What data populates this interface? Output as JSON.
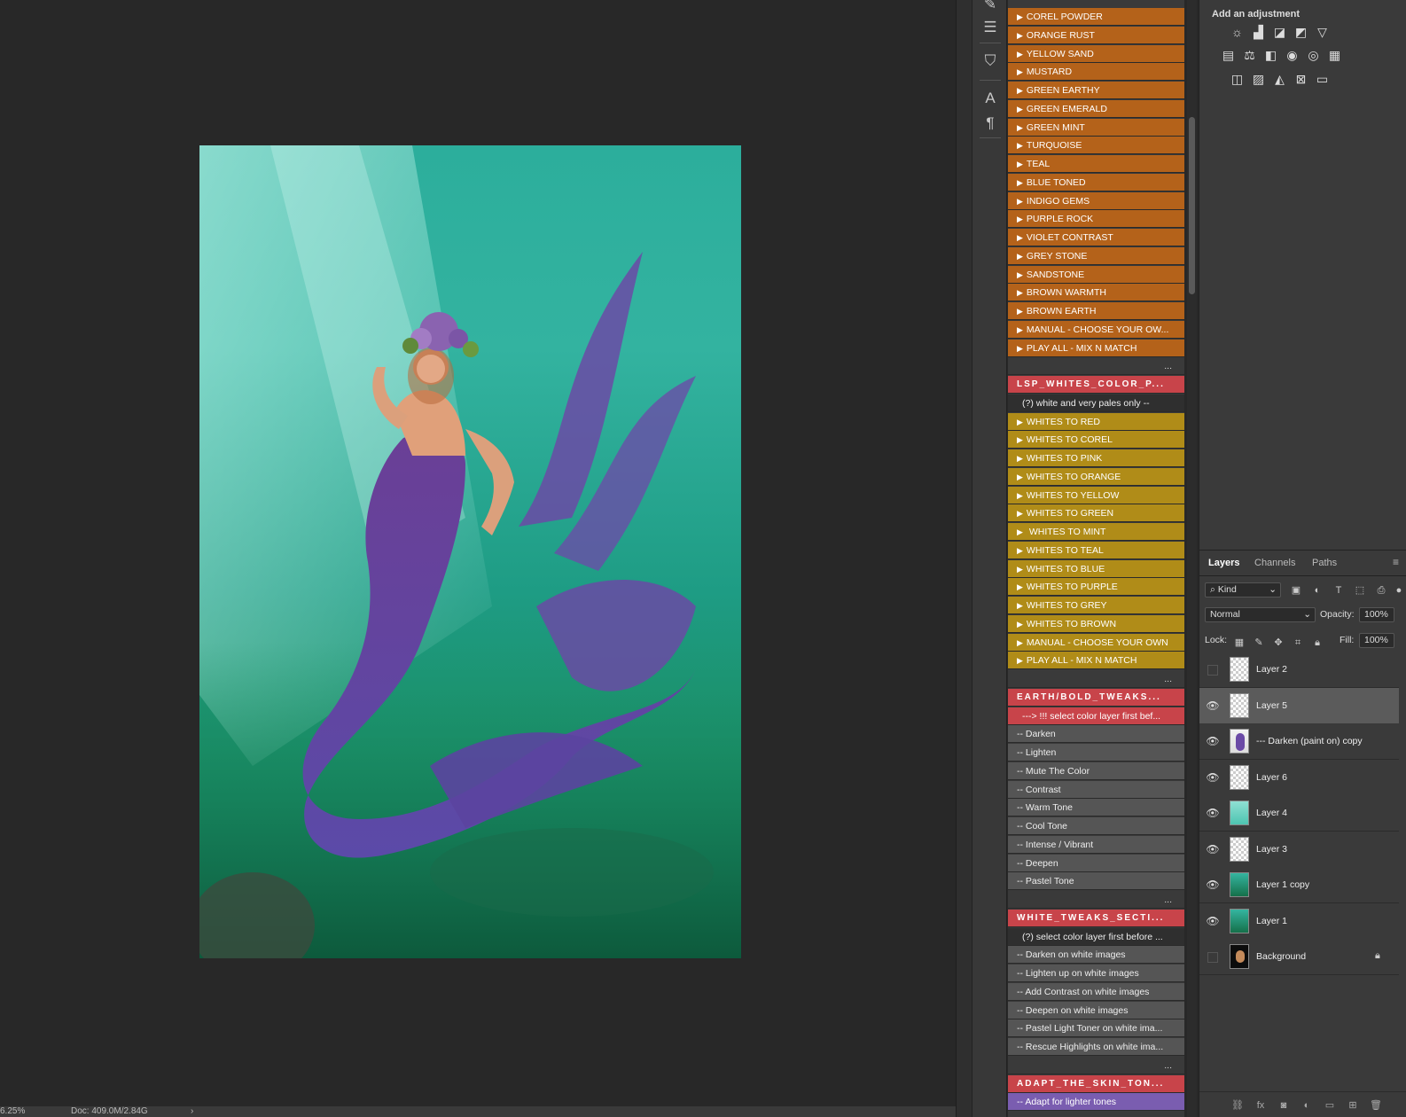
{
  "status": {
    "zoom": "6.25%",
    "doc": "Doc: 409.0M/2.84G",
    "arrow": "›"
  },
  "actions": {
    "group1": [
      "COREL POWDER",
      "ORANGE RUST",
      "YELLOW SAND",
      "MUSTARD",
      "GREEN EARTHY",
      "GREEN EMERALD",
      "GREEN MINT",
      "TURQUOISE",
      "TEAL",
      "BLUE TONED",
      "INDIGO GEMS",
      "PURPLE ROCK",
      "VIOLET CONTRAST",
      "GREY STONE",
      "SANDSTONE",
      "BROWN WARMTH",
      "BROWN EARTH",
      "MANUAL - CHOOSE YOUR OW...",
      "PLAY ALL - MIX N MATCH"
    ],
    "sep": "...",
    "set_whites": "LSP_WHITES_COLOR_P...",
    "whites_note": "(?) white and very pales only --",
    "group2": [
      "WHITES TO  RED",
      "WHITES TO  COREL",
      "WHITES TO  PINK",
      "WHITES TO  ORANGE",
      "WHITES TO  YELLOW",
      "WHITES TO  GREEN",
      " WHITES TO  MINT",
      "WHITES TO  TEAL",
      "WHITES TO   BLUE",
      "WHITES TO  PURPLE",
      "WHITES TO  GREY",
      "WHITES TO  BROWN",
      "MANUAL - CHOOSE YOUR OWN",
      "PLAY ALL - MIX N MATCH"
    ],
    "set_earth": "EARTH/BOLD_TWEAKS...",
    "earth_note": "---> !!! select color layer first bef...",
    "group3": [
      "-- Darken",
      "-- Lighten",
      "-- Mute The Color",
      "-- Contrast",
      "-- Warm Tone",
      "-- Cool Tone",
      "-- Intense / Vibrant",
      "-- Deepen",
      "-- Pastel Tone"
    ],
    "set_white_tweaks": "WHITE_TWEAKS_SECTI...",
    "white_tweaks_note": "(?)  select color layer first before ...",
    "group4": [
      "-- Darken on white images",
      "-- Lighten up on white images",
      "-- Add Contrast on white images",
      "-- Deepen on white images",
      "-- Pastel Light Toner on white ima...",
      "-- Rescue Highlights on white ima..."
    ],
    "set_skin": "ADAPT_THE_SKIN_TON...",
    "skin_first": "-- Adapt for lighter tones"
  },
  "adjustments": {
    "title": "Add an adjustment",
    "row1": [
      "brightness-icon",
      "levels-icon",
      "curves-icon",
      "exposure-icon",
      "vibrance-icon"
    ],
    "row2": [
      "hue-saturation-icon",
      "color-balance-icon",
      "black-white-icon",
      "photo-filter-icon",
      "channel-mixer-icon",
      "color-lookup-icon"
    ],
    "row3": [
      "invert-icon",
      "posterize-icon",
      "threshold-icon",
      "selective-color-icon",
      "gradient-map-icon"
    ]
  },
  "layers_panel": {
    "tabs": [
      "Layers",
      "Channels",
      "Paths"
    ],
    "kind": "Kind",
    "blend_mode": "Normal",
    "opacity_label": "Opacity:",
    "opacity_value": "100%",
    "lock_label": "Lock:",
    "fill_label": "Fill:",
    "fill_value": "100%",
    "layers": [
      {
        "name": "Layer 2",
        "visible": false,
        "thumb": "transparent"
      },
      {
        "name": "Layer 5",
        "visible": true,
        "thumb": "transparent",
        "selected": true
      },
      {
        "name": "--- Darken (paint on) copy",
        "visible": true,
        "thumb": "figure"
      },
      {
        "name": "Layer 6",
        "visible": true,
        "thumb": "transparent"
      },
      {
        "name": "Layer 4",
        "visible": true,
        "thumb": "teal-light"
      },
      {
        "name": "Layer 3",
        "visible": true,
        "thumb": "transparent"
      },
      {
        "name": "Layer 1 copy",
        "visible": true,
        "thumb": "teal"
      },
      {
        "name": "Layer 1",
        "visible": true,
        "thumb": "teal"
      },
      {
        "name": "Background",
        "visible": false,
        "thumb": "bg",
        "locked": true
      }
    ]
  }
}
